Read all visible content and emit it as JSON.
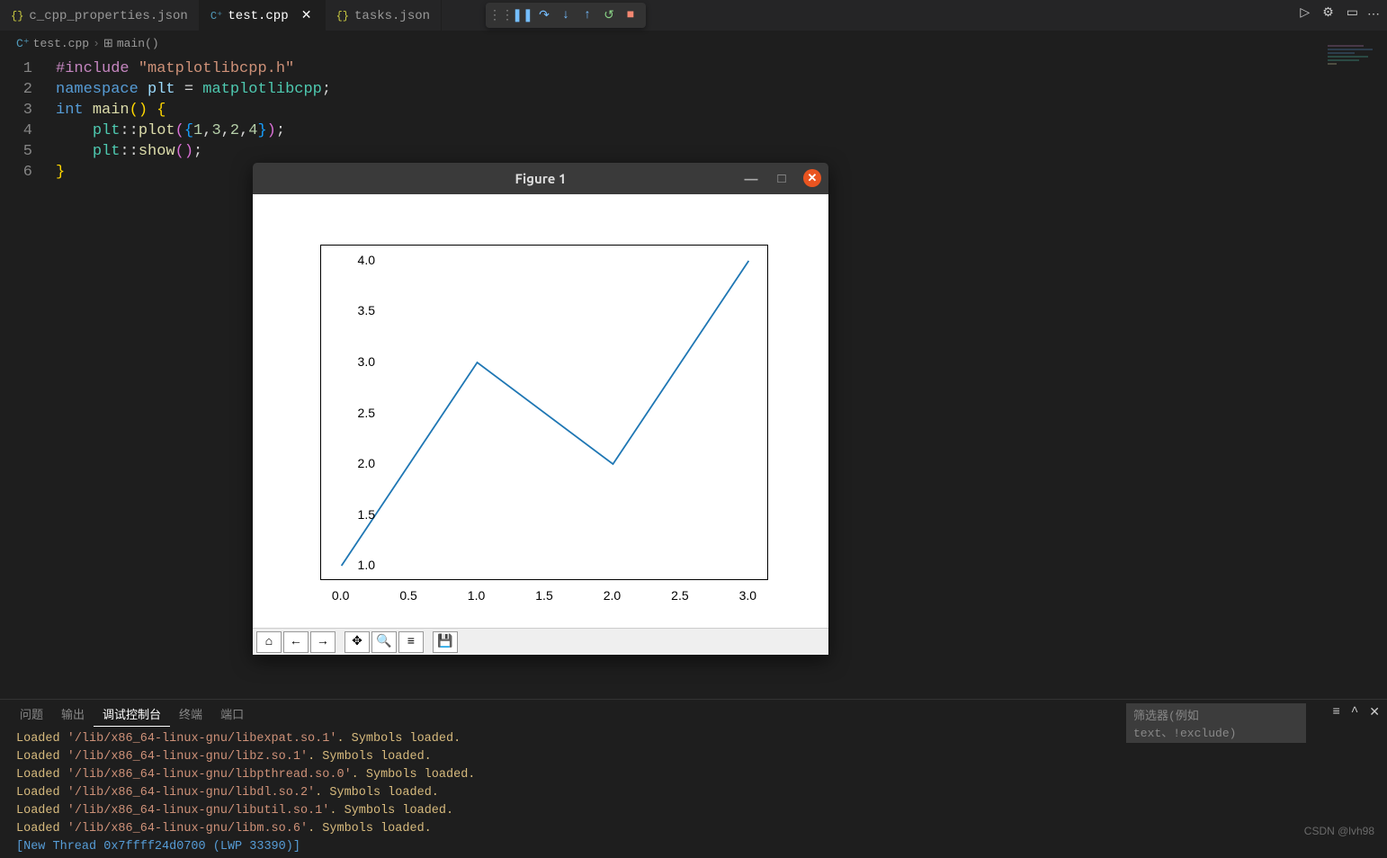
{
  "tabs": [
    {
      "icon": "{}",
      "label": "c_cpp_properties.json",
      "active": false,
      "icon_class": "json-icon"
    },
    {
      "icon": "C⁺",
      "label": "test.cpp",
      "active": true,
      "icon_class": "cpp-icon"
    },
    {
      "icon": "{}",
      "label": "tasks.json",
      "active": false,
      "icon_class": "json-icon"
    }
  ],
  "breadcrumb": {
    "file_icon": "C⁺",
    "file": "test.cpp",
    "symbol_icon": "⊞",
    "symbol": "main()"
  },
  "debug_icons": [
    "⋮⋮",
    "❚❚",
    "↷",
    "↓",
    "↑",
    "↺",
    "■"
  ],
  "titlebar_icons": {
    "run": "▷",
    "gear": "⚙",
    "layout": "▭",
    "more": "⋯"
  },
  "code": {
    "lines": [
      {
        "n": "1",
        "html": "<span class='mac'>#include</span> <span class='str'>\"matplotlibcpp.h\"</span>"
      },
      {
        "n": "2",
        "html": "<span class='kw'>namespace</span> <span class='id'>plt</span> <span class='op'>=</span> <span class='cls'>matplotlibcpp</span><span class='op'>;</span>"
      },
      {
        "n": "3",
        "html": "<span class='kw'>int</span> <span class='fn'>main</span><span class='yel'>()</span> <span class='yel'>{</span>"
      },
      {
        "n": "4",
        "html": "    <span class='cls'>plt</span><span class='op'>::</span><span class='fn'>plot</span><span class='pnk'>(</span><span class='blu'>{</span><span class='num'>1</span><span class='op'>,</span><span class='num'>3</span><span class='op'>,</span><span class='num'>2</span><span class='op'>,</span><span class='num'>4</span><span class='blu'>}</span><span class='pnk'>)</span><span class='op'>;</span>"
      },
      {
        "n": "5",
        "html": "    <span class='cls'>plt</span><span class='op'>::</span><span class='fn'>show</span><span class='pnk'>()</span><span class='op'>;</span>"
      },
      {
        "n": "6",
        "html": "<span class='yel'>}</span>"
      }
    ]
  },
  "figure": {
    "title": "Figure 1",
    "toolbar_icons": [
      "⌂",
      "←",
      "→",
      "",
      "✥",
      "🔍",
      "≡",
      "",
      "💾"
    ]
  },
  "chart_data": {
    "type": "line",
    "x": [
      0,
      1,
      2,
      3
    ],
    "values": [
      1,
      3,
      2,
      4
    ],
    "xlim": [
      -0.15,
      3.15
    ],
    "ylim": [
      0.85,
      4.15
    ],
    "xticks": [
      "0.0",
      "0.5",
      "1.0",
      "1.5",
      "2.0",
      "2.5",
      "3.0"
    ],
    "yticks": [
      "1.0",
      "1.5",
      "2.0",
      "2.5",
      "3.0",
      "3.5",
      "4.0"
    ],
    "title": "",
    "xlabel": "",
    "ylabel": ""
  },
  "panel": {
    "tabs": [
      "问题",
      "输出",
      "调试控制台",
      "终端",
      "端口"
    ],
    "active_tab": "调试控制台",
    "filter_placeholder": "筛选器(例如 text、!exclude)",
    "console_lines": [
      {
        "pre": "Loaded ",
        "path": "'/lib/x86_64-linux-gnu/libexpat.so.1'",
        "post": ". Symbols loaded."
      },
      {
        "pre": "Loaded ",
        "path": "'/lib/x86_64-linux-gnu/libz.so.1'",
        "post": ". Symbols loaded."
      },
      {
        "pre": "Loaded ",
        "path": "'/lib/x86_64-linux-gnu/libpthread.so.0'",
        "post": ". Symbols loaded."
      },
      {
        "pre": "Loaded ",
        "path": "'/lib/x86_64-linux-gnu/libdl.so.2'",
        "post": ". Symbols loaded."
      },
      {
        "pre": "Loaded ",
        "path": "'/lib/x86_64-linux-gnu/libutil.so.1'",
        "post": ". Symbols loaded."
      },
      {
        "pre": "Loaded ",
        "path": "'/lib/x86_64-linux-gnu/libm.so.6'",
        "post": ". Symbols loaded."
      }
    ],
    "thread_line": "[New Thread 0x7ffff24d0700 (LWP 33390)]"
  },
  "watermark": "CSDN @lvh98"
}
